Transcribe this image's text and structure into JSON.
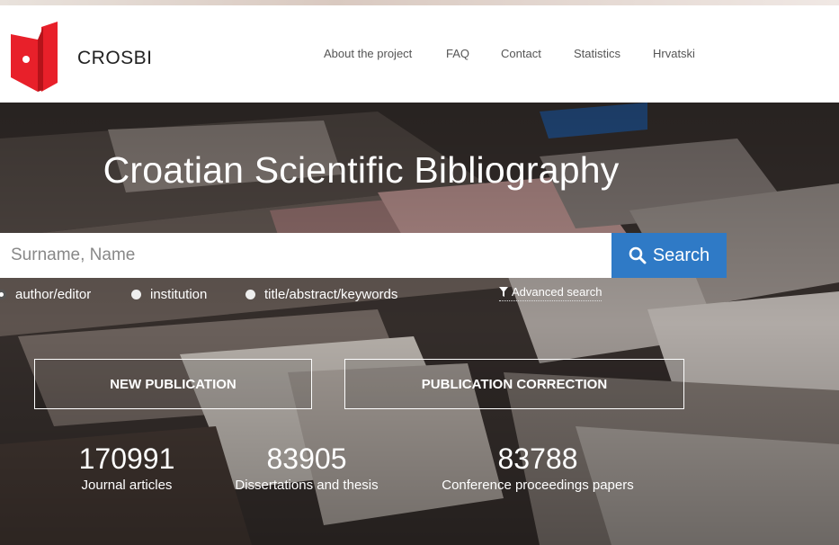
{
  "header": {
    "brand": "CROSBI",
    "nav": [
      "About the project",
      "FAQ",
      "Contact",
      "Statistics",
      "Hrvatski"
    ]
  },
  "hero": {
    "title": "Croatian Scientific Bibliography",
    "search_placeholder": "Surname, Name",
    "search_button": "Search",
    "search_options": [
      {
        "label": "author/editor",
        "selected": true
      },
      {
        "label": "institution",
        "selected": false
      },
      {
        "label": "title/abstract/keywords",
        "selected": false
      }
    ],
    "advanced_search": "Advanced search",
    "new_publication": "NEW PUBLICATION",
    "publication_correction": "PUBLICATION CORRECTION"
  },
  "stats": [
    {
      "value": "170991",
      "label": "Journal articles"
    },
    {
      "value": "83905",
      "label": "Dissertations and thesis"
    },
    {
      "value": "83788",
      "label": "Conference proceedings papers"
    }
  ],
  "colors": {
    "accent": "#2f7ac6",
    "logo": "#e8202a"
  }
}
